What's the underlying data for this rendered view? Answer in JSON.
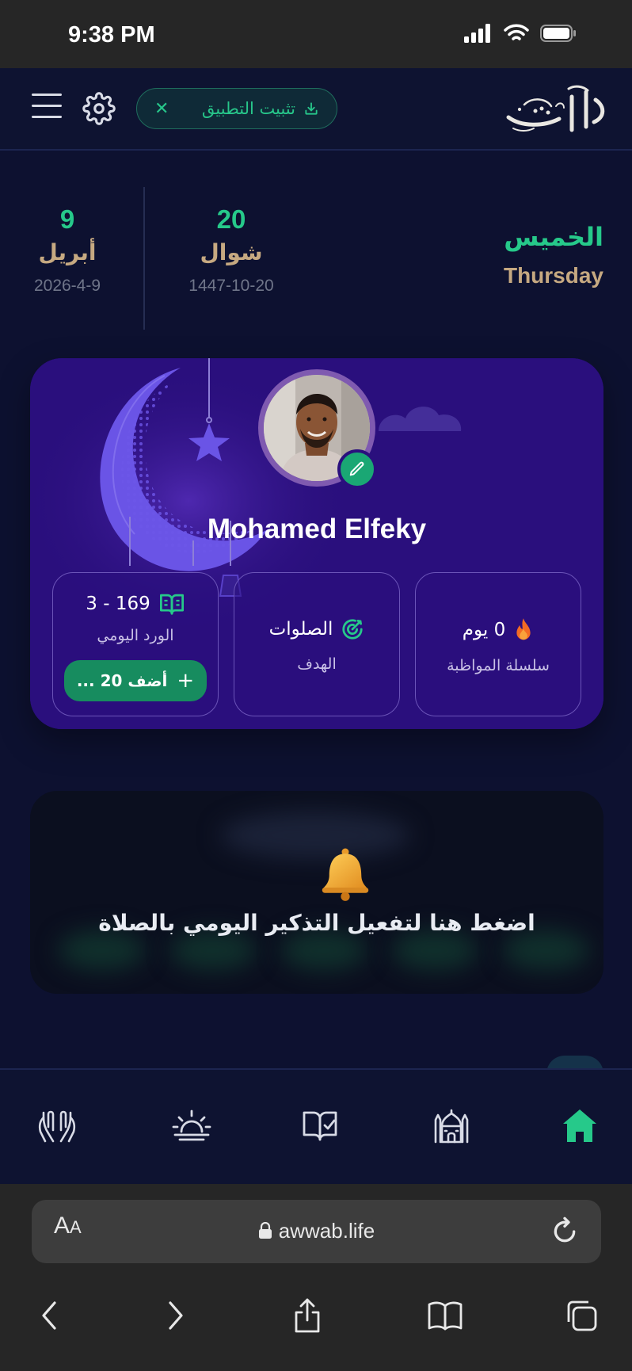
{
  "status_bar": {
    "time": "9:38 PM"
  },
  "header": {
    "install_label": "تثبيت التطبيق",
    "close_glyph": "✕",
    "logo_icon": "awwab-calligraphy-logo",
    "settings_icon": "gear-icon",
    "menu_icon": "hamburger-icon"
  },
  "dates": {
    "gregorian": {
      "day": "9",
      "month": "أبريل",
      "full": "2026-4-9"
    },
    "hijri": {
      "day": "20",
      "month": "شوال",
      "full": "1447-10-20"
    },
    "weekday": {
      "ar": "الخميس",
      "en": "Thursday"
    }
  },
  "profile": {
    "name": "Mohamed Elfeky",
    "stats": {
      "streak": {
        "value": "0 يوم",
        "label": "سلسلة المواظبة",
        "icon": "flame-icon"
      },
      "goal": {
        "value": "الصلوات",
        "label": "الهدف",
        "icon": "target-icon"
      },
      "wird": {
        "value": "3 - 169",
        "label": "الورد اليومي",
        "icon": "open-book-icon",
        "add_label": "أضف 20 ..."
      }
    }
  },
  "reminder": {
    "text": "اضغط هنا لتفعيل التذكير اليومي بالصلاة",
    "icon": "bell-icon"
  },
  "nav": [
    "praying-hands-icon",
    "sunrise-icon",
    "book-check-icon",
    "mosque-icon",
    "home-icon"
  ],
  "browser": {
    "aa_big": "A",
    "aa_small": "A",
    "url": "awwab.life"
  },
  "colors": {
    "accent": "#26c98a",
    "gold": "#c6a981",
    "card_purple": "#2a0f7d",
    "background": "#0d1130"
  }
}
